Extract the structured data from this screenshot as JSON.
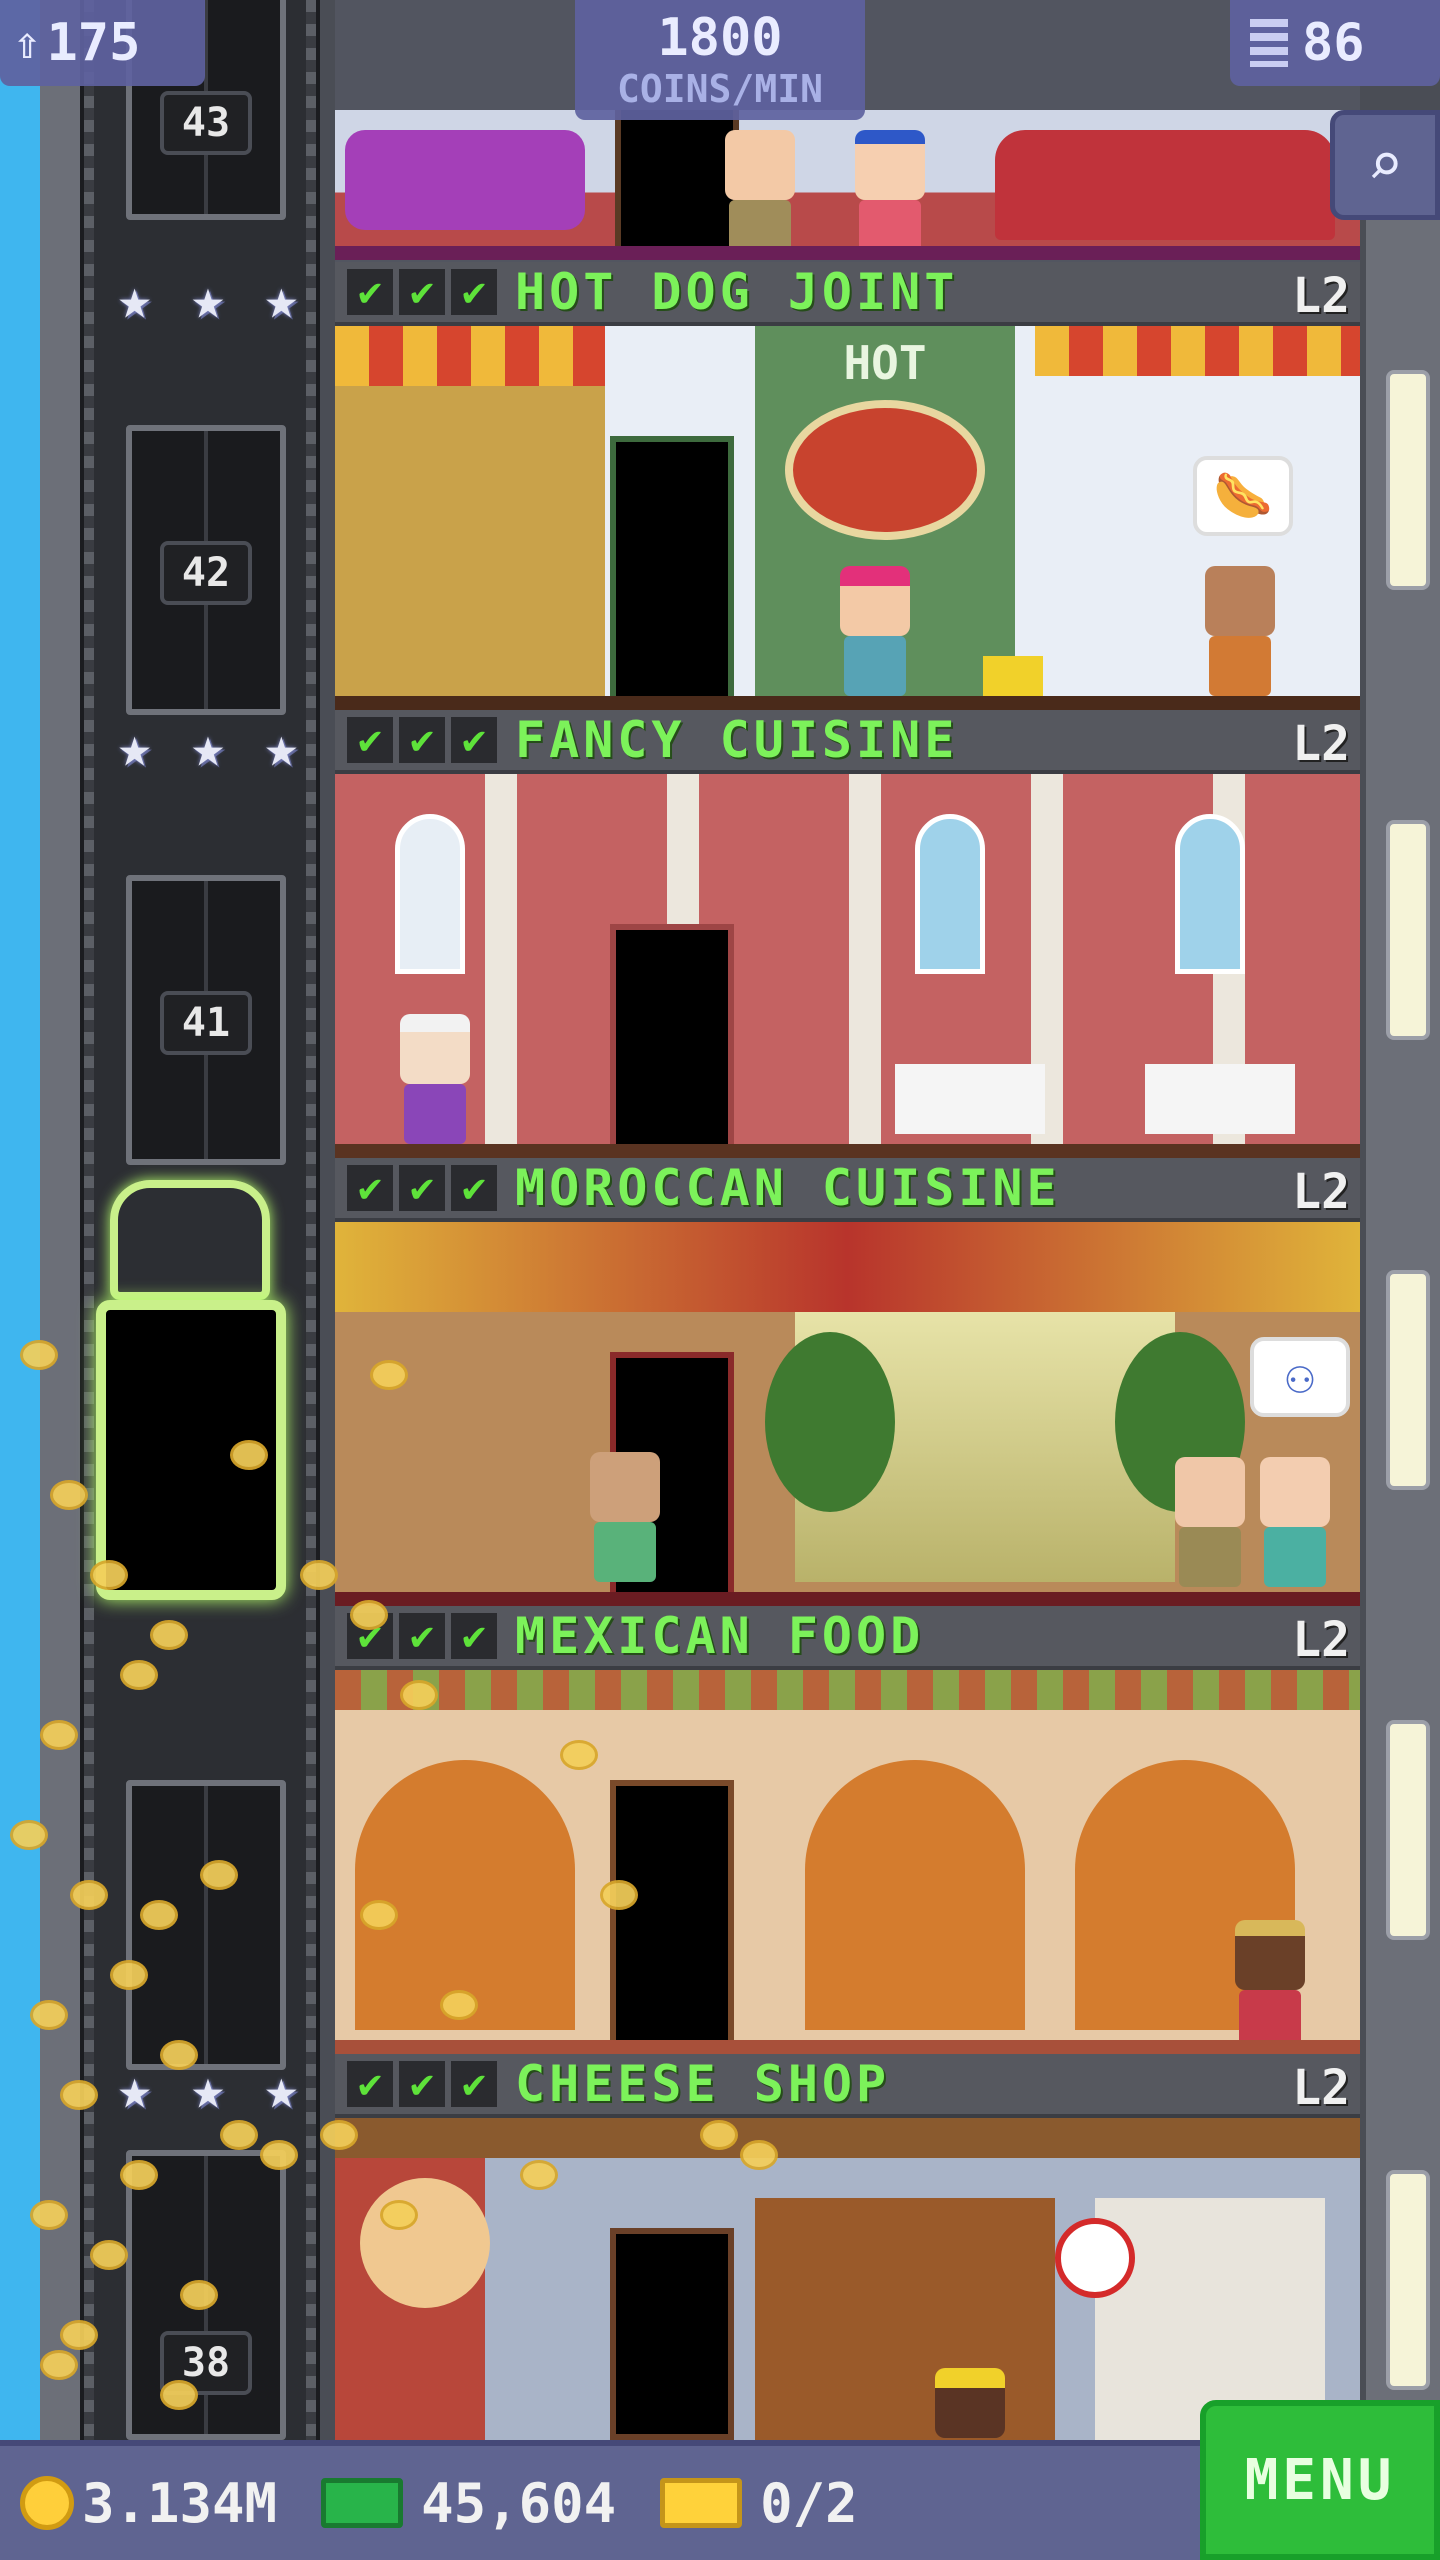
{
  "hud": {
    "population": "175",
    "coins_rate_value": "1800",
    "coins_rate_unit": "COINS/MIN",
    "floor_count": "86",
    "coins": "3.134M",
    "bux": "45,604",
    "bits": "0/2",
    "menu_label": "MENU"
  },
  "icons": {
    "population": "person-up-icon",
    "floors": "building-icon",
    "search": "magnifier-icon",
    "coins": "coin-icon",
    "bux": "tower-bux-icon",
    "bits": "golden-ticket-icon",
    "stars": "star-icon",
    "checks": "checkmark-icon"
  },
  "colors": {
    "floor_name": "#7cf25a",
    "hud_bg": "#5f6491",
    "menu_bg": "#2ebd3a",
    "coin": "#ffcf3a",
    "sky": "#3fb6ef"
  },
  "elevator_floors": [
    "43",
    "42",
    "41",
    "38"
  ],
  "check_mark": "✔",
  "star_glyph": "★",
  "floors": [
    {
      "name": "HOT DOG JOINT",
      "level": "L2",
      "sign": "HOT",
      "bubble": "🌭"
    },
    {
      "name": "FANCY CUISINE",
      "level": "L2"
    },
    {
      "name": "MOROCCAN CUISINE",
      "level": "L2",
      "bubble": "⚇"
    },
    {
      "name": "MEXICAN FOOD",
      "level": "L2"
    },
    {
      "name": "CHEESE SHOP",
      "level": "L2"
    }
  ]
}
